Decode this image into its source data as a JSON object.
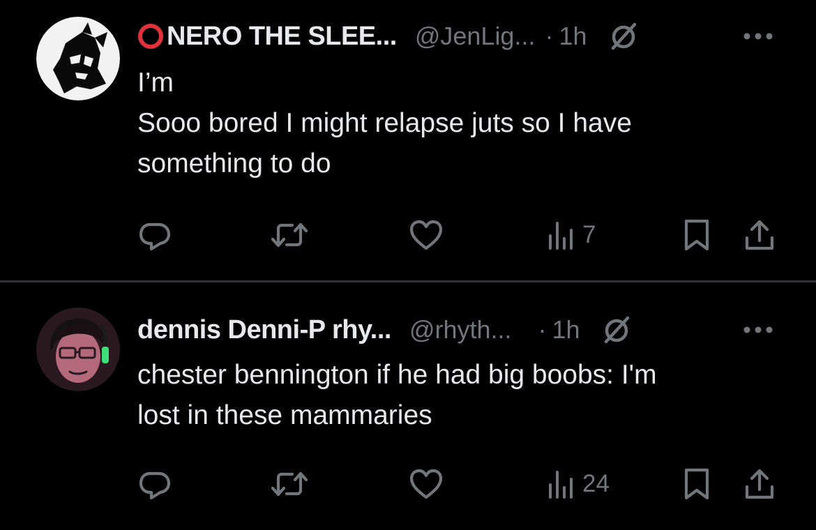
{
  "colors": {
    "background": "#000000",
    "text_primary": "#e7e9ea",
    "text_secondary": "#71767b",
    "divider": "#2f3336",
    "name_ring": "#e0323c"
  },
  "tweets": [
    {
      "display_name": "NERO THE SLEE...",
      "name_prefix_icon": "red-ring-icon",
      "handle": "@JenLig...",
      "separator": "·",
      "time": "1h",
      "header_icon": "grok-icon",
      "menu_icon": "more-options-icon",
      "text_lines": [
        "I’m",
        "Sooo bored I might relapse juts so I have",
        "something to do"
      ],
      "actions": {
        "reply_icon": "reply-icon",
        "repost_icon": "repost-icon",
        "like_icon": "like-icon",
        "views_icon": "views-icon",
        "views": "7",
        "bookmark_icon": "bookmark-icon",
        "share_icon": "share-icon"
      }
    },
    {
      "display_name": "dennis Denni-P rhy...",
      "handle": "@rhyth...",
      "separator": "·",
      "time": "1h",
      "header_icon": "grok-icon",
      "menu_icon": "more-options-icon",
      "text_lines": [
        "chester bennington if he had big boobs: I'm",
        "lost in these mammaries"
      ],
      "actions": {
        "reply_icon": "reply-icon",
        "repost_icon": "repost-icon",
        "like_icon": "like-icon",
        "views_icon": "views-icon",
        "views": "24",
        "bookmark_icon": "bookmark-icon",
        "share_icon": "share-icon"
      }
    }
  ]
}
